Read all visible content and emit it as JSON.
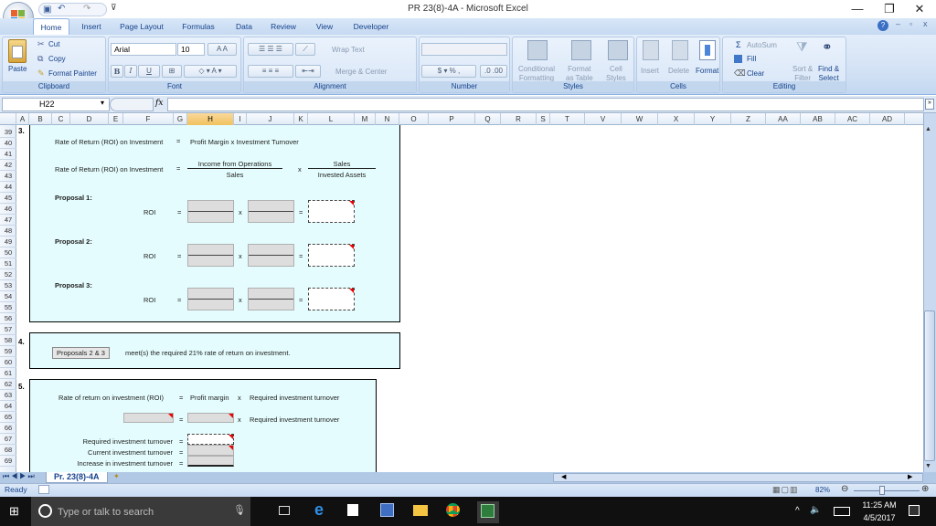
{
  "window": {
    "title": "PR 23(8)-4A - Microsoft Excel",
    "minimize": "—",
    "restore": "❐",
    "close": "✕"
  },
  "ribbon_tabs": [
    {
      "label": "Home",
      "active": true
    },
    {
      "label": "Insert"
    },
    {
      "label": "Page Layout"
    },
    {
      "label": "Formulas"
    },
    {
      "label": "Data"
    },
    {
      "label": "Review"
    },
    {
      "label": "View"
    },
    {
      "label": "Developer"
    }
  ],
  "ribbon": {
    "clipboard": {
      "label": "Clipboard",
      "paste": "Paste",
      "cut": "Cut",
      "copy": "Copy",
      "format_painter": "Format Painter"
    },
    "font": {
      "label": "Font",
      "font_name": "Arial",
      "font_size": "10",
      "bold": "B",
      "italic": "I",
      "underline": "U"
    },
    "alignment": {
      "label": "Alignment",
      "wrap_text": "Wrap Text",
      "merge_center": "Merge & Center"
    },
    "number": {
      "label": "Number",
      "format": "",
      "currency": "$",
      "percent": "%",
      "comma": ","
    },
    "styles": {
      "label": "Styles",
      "conditional": "Conditional",
      "conditional2": "Formatting",
      "format_table": "Format",
      "format_table2": "as Table",
      "cell_styles": "Cell",
      "cell_styles2": "Styles"
    },
    "cells": {
      "label": "Cells",
      "insert": "Insert",
      "delete": "Delete",
      "format": "Format"
    },
    "editing": {
      "label": "Editing",
      "autosum": "AutoSum",
      "fill": "Fill",
      "clear": "Clear",
      "sort_filter": "Sort &",
      "sort_filter2": "Filter",
      "find_select": "Find &",
      "find_select2": "Select"
    }
  },
  "formula_bar": {
    "name_box": "H22",
    "fx": "fx",
    "formula": ""
  },
  "columns": [
    "A",
    "B",
    "C",
    "D",
    "E",
    "F",
    "G",
    "H",
    "I",
    "J",
    "K",
    "L",
    "M",
    "N",
    "O",
    "P",
    "Q",
    "R",
    "S",
    "T",
    "V",
    "W",
    "X",
    "Y",
    "Z",
    "AA",
    "AB",
    "AC",
    "AD"
  ],
  "selected_column": "H",
  "rows": [
    "39",
    "40",
    "41",
    "42",
    "43",
    "44",
    "45",
    "46",
    "47",
    "48",
    "49",
    "50",
    "51",
    "52",
    "53",
    "54",
    "55",
    "56",
    "57",
    "58",
    "59",
    "60",
    "61",
    "62",
    "63",
    "64",
    "65",
    "66",
    "67",
    "68",
    "69"
  ],
  "section3": {
    "number": "3.",
    "line1_label": "Rate of Return (ROI) on Investment",
    "eq": "=",
    "line1_value": "Profit Margin x Investment Turnover",
    "line2_label": "Rate of Return (ROI) on Investment",
    "numerator1": "Income from Operations",
    "denominator1": "Sales",
    "times": "x",
    "numerator2": "Sales",
    "denominator2": "Invested Assets",
    "proposals": [
      {
        "title": "Proposal 1:",
        "roi": "ROI"
      },
      {
        "title": "Proposal 2:",
        "roi": "ROI"
      },
      {
        "title": "Proposal 3:",
        "roi": "ROI"
      }
    ]
  },
  "section4": {
    "number": "4.",
    "answer": "Proposals 2 & 3",
    "text": "meet(s) the required 21% rate of return on investment."
  },
  "section5": {
    "number": "5.",
    "formula_label": "Rate of return on investment (ROI)",
    "eq": "=",
    "profit_margin": "Profit margin",
    "times": "x",
    "req_turnover": "Required investment turnover",
    "rows": [
      {
        "label": "Required investment turnover"
      },
      {
        "label": "Current investment turnover"
      },
      {
        "label": "Increase in investment turnover"
      }
    ]
  },
  "sheet_tabs": [
    {
      "label": "Pr. 23(8)-4A",
      "active": true
    }
  ],
  "status": {
    "text": "Ready",
    "zoom": "82%"
  },
  "taskbar": {
    "search_placeholder": "Type or talk to search",
    "time": "11:25 AM",
    "date": "4/5/2017"
  }
}
